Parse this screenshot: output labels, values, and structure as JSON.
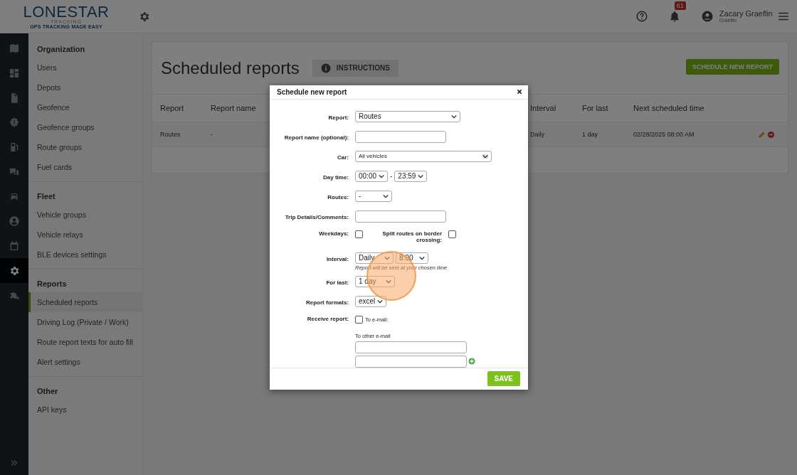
{
  "header": {
    "logo": {
      "name": "LONESTAR",
      "sub": "TRACKING",
      "tagline": "GPS TRACKING MADE EASY"
    },
    "notifications": {
      "count": "61"
    },
    "user": {
      "name": "Zacary Graeflin",
      "company": "Graeflin"
    }
  },
  "rail": [
    {
      "selected": false
    },
    {
      "selected": false
    },
    {
      "selected": false
    },
    {
      "selected": false
    },
    {
      "selected": false
    },
    {
      "selected": false
    },
    {
      "selected": false
    },
    {
      "selected": false
    },
    {
      "selected": false
    },
    {
      "selected": true
    },
    {
      "selected": false
    }
  ],
  "menu": [
    {
      "title": "Organization",
      "items": [
        {
          "label": "Users",
          "selected": false
        },
        {
          "label": "Depots",
          "selected": false
        },
        {
          "label": "Geofence",
          "selected": false
        },
        {
          "label": "Geofence groups",
          "selected": false
        },
        {
          "label": "Route groups",
          "selected": false
        },
        {
          "label": "Fuel cards",
          "selected": false
        }
      ]
    },
    {
      "title": "Fleet",
      "items": [
        {
          "label": "Vehicle groups",
          "selected": false
        },
        {
          "label": "Vehicle relays",
          "selected": false
        },
        {
          "label": "BLE devices settings",
          "selected": false
        }
      ]
    },
    {
      "title": "Reports",
      "items": [
        {
          "label": "Scheduled reports",
          "selected": true
        },
        {
          "label": "Driving Log (Private / Work)",
          "selected": false
        },
        {
          "label": "Route report texts for auto fill",
          "selected": false
        },
        {
          "label": "Alert settings",
          "selected": false
        }
      ]
    },
    {
      "title": "Other",
      "items": [
        {
          "label": "API keys",
          "selected": false
        }
      ]
    }
  ],
  "page": {
    "title": "Scheduled reports",
    "instructions_button": "INSTRUCTIONS",
    "new_button": "SCHEDULE NEW REPORT",
    "table": {
      "columns": [
        "Report",
        "Report name",
        "Interval",
        "For last",
        "Next scheduled time"
      ],
      "rows": [
        {
          "cells": [
            "Routes",
            "-",
            "Daily",
            "1 day",
            "02/28/2025 08:00 AM"
          ]
        }
      ]
    }
  },
  "dialog": {
    "title": "Schedule new report",
    "fields": [
      {
        "kind": "row",
        "label": "Report:",
        "controls": [
          {
            "kind": "select",
            "value": "Routes"
          }
        ]
      },
      {
        "kind": "row",
        "label": "Report name (optional):",
        "controls": [
          {
            "kind": "input"
          }
        ]
      },
      {
        "kind": "row",
        "label": "Car:",
        "controls": [
          {
            "kind": "select",
            "value": "All vehicles"
          }
        ]
      },
      {
        "kind": "row",
        "label": "Day time:",
        "controls": [
          {
            "kind": "select",
            "value": "00:00"
          },
          {
            "kind": "text",
            "value": "-"
          },
          {
            "kind": "select",
            "value": "23:59"
          }
        ]
      },
      {
        "kind": "row",
        "label": "Routes:",
        "controls": [
          {
            "kind": "select",
            "value": "-"
          }
        ]
      },
      {
        "kind": "row",
        "label": "Trip Details/Comments:",
        "controls": [
          {
            "kind": "input"
          }
        ]
      },
      {
        "kind": "row",
        "label": "Weekdays:",
        "controls": [
          {
            "kind": "checkbox",
            "checked": false
          },
          {
            "kind": "label",
            "value": "Split routes on border crossing:"
          },
          {
            "kind": "checkbox",
            "checked": false
          }
        ]
      },
      {
        "kind": "row",
        "label": "Interval:",
        "controls": [
          {
            "kind": "select",
            "value": "Daily"
          },
          {
            "kind": "select",
            "value": "8:00"
          }
        ],
        "note": "Report will be sent at your chosen time"
      },
      {
        "kind": "row",
        "label": "For last:",
        "controls": [
          {
            "kind": "select",
            "value": "1 day"
          }
        ]
      },
      {
        "kind": "row",
        "label": "Report formats:",
        "controls": [
          {
            "kind": "select",
            "value": "excel"
          }
        ]
      },
      {
        "kind": "row",
        "label": "Receive report:",
        "controls": [
          {
            "kind": "checkbox",
            "checked": false
          },
          {
            "kind": "plain",
            "value": "To e-mail:"
          }
        ]
      },
      {
        "kind": "emails",
        "label": "To other e-mail",
        "inputs": [
          {
            "add_button": false
          },
          {
            "add_button": true
          }
        ]
      }
    ],
    "save_button": "SAVE"
  }
}
